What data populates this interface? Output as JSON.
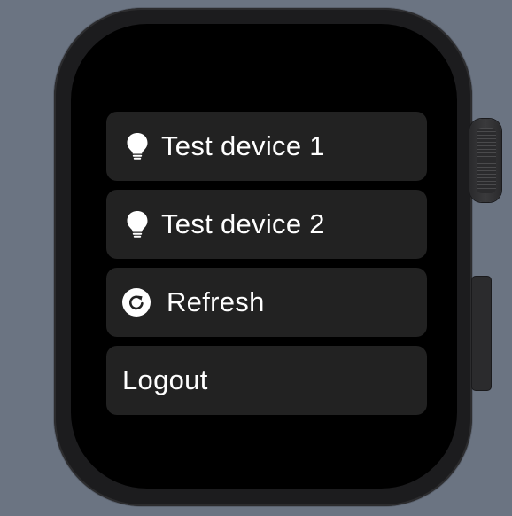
{
  "menu": {
    "items": [
      {
        "label": "Test device 1",
        "icon": "lightbulb-icon"
      },
      {
        "label": "Test device 2",
        "icon": "lightbulb-icon"
      },
      {
        "label": "Refresh",
        "icon": "refresh-icon"
      },
      {
        "label": "Logout"
      }
    ]
  },
  "colors": {
    "background": "#6b7482",
    "screen": "#000000",
    "item_background": "#222222",
    "text": "#ffffff"
  }
}
